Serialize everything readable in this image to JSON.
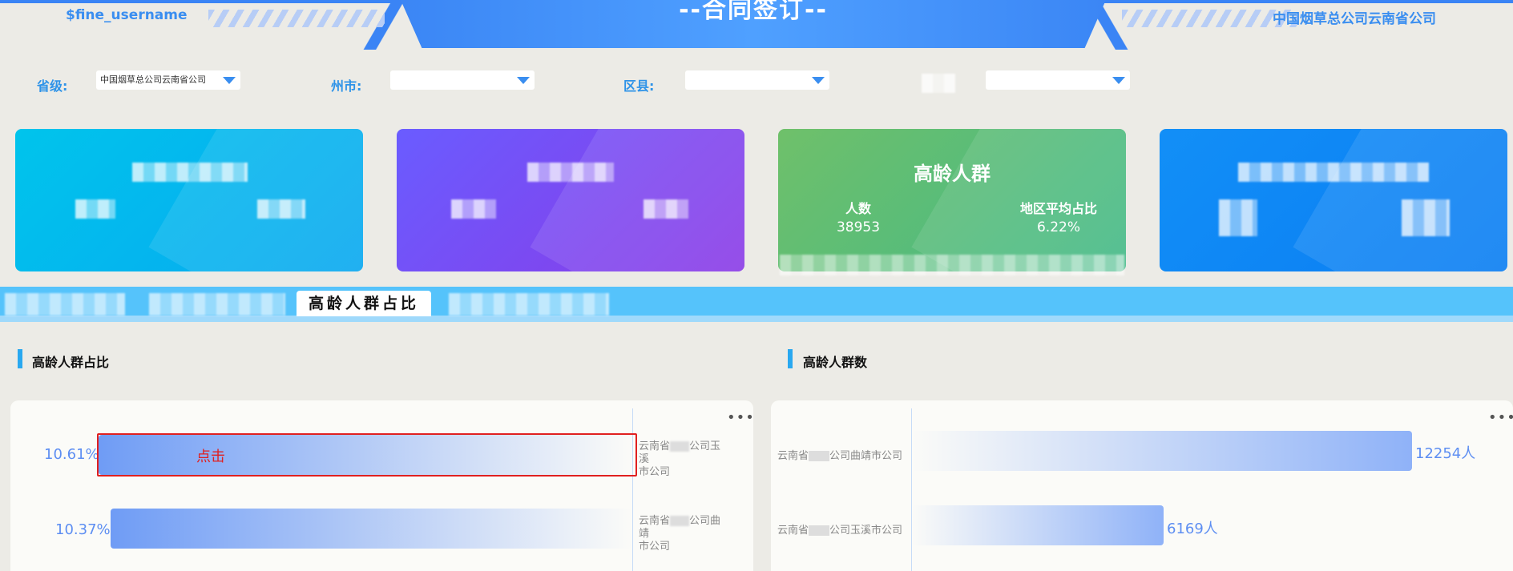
{
  "header": {
    "username": "$fine_username",
    "title": "--合同签订--",
    "org": "中国烟草总公司云南省公司"
  },
  "filters": {
    "province": {
      "label": "省级:",
      "value": "中国烟草总公司云南省公司"
    },
    "city": {
      "label": "州市:",
      "value": ""
    },
    "county": {
      "label": "区县:",
      "value": ""
    },
    "fourth": {
      "label": "",
      "value": ""
    }
  },
  "cards": {
    "elderly": {
      "title": "高龄人群",
      "count_label": "人数",
      "count_value": "38953",
      "ratio_label": "地区平均占比",
      "ratio_value": "6.22%"
    }
  },
  "tabs": {
    "active": "高龄人群占比"
  },
  "sections": {
    "left_title": "高龄人群占比",
    "right_title": "高龄人群数",
    "menu": "•••"
  },
  "click_hint": "点击",
  "chart_data": [
    {
      "type": "bar",
      "orientation": "horizontal",
      "categories": [
        "云南省公司玉溪市公司",
        "云南省公司曲靖市公司"
      ],
      "values": [
        10.61,
        10.37
      ],
      "value_labels": [
        "10.61%",
        "10.37%"
      ],
      "category_labels": [
        {
          "line1": "云南省",
          "line1b": "公司玉溪",
          "line2": "市公司"
        },
        {
          "line1": "云南省",
          "line1b": "公司曲靖",
          "line2": "市公司"
        }
      ],
      "unit": "%",
      "xlim": [
        0,
        10.61
      ],
      "bar_color": "#6f9cf5"
    },
    {
      "type": "bar",
      "orientation": "horizontal",
      "categories": [
        "云南省公司曲靖市公司",
        "云南省公司玉溪市公司"
      ],
      "values": [
        12254,
        6169
      ],
      "value_labels": [
        "12254人",
        "6169人"
      ],
      "category_labels": [
        {
          "a": "云南省",
          "b": "公司曲靖市公司"
        },
        {
          "a": "云南省",
          "b": "公司玉溪市公司"
        }
      ],
      "unit": "人",
      "xlim": [
        0,
        12254
      ],
      "bar_color": "#8fb2f8"
    }
  ]
}
